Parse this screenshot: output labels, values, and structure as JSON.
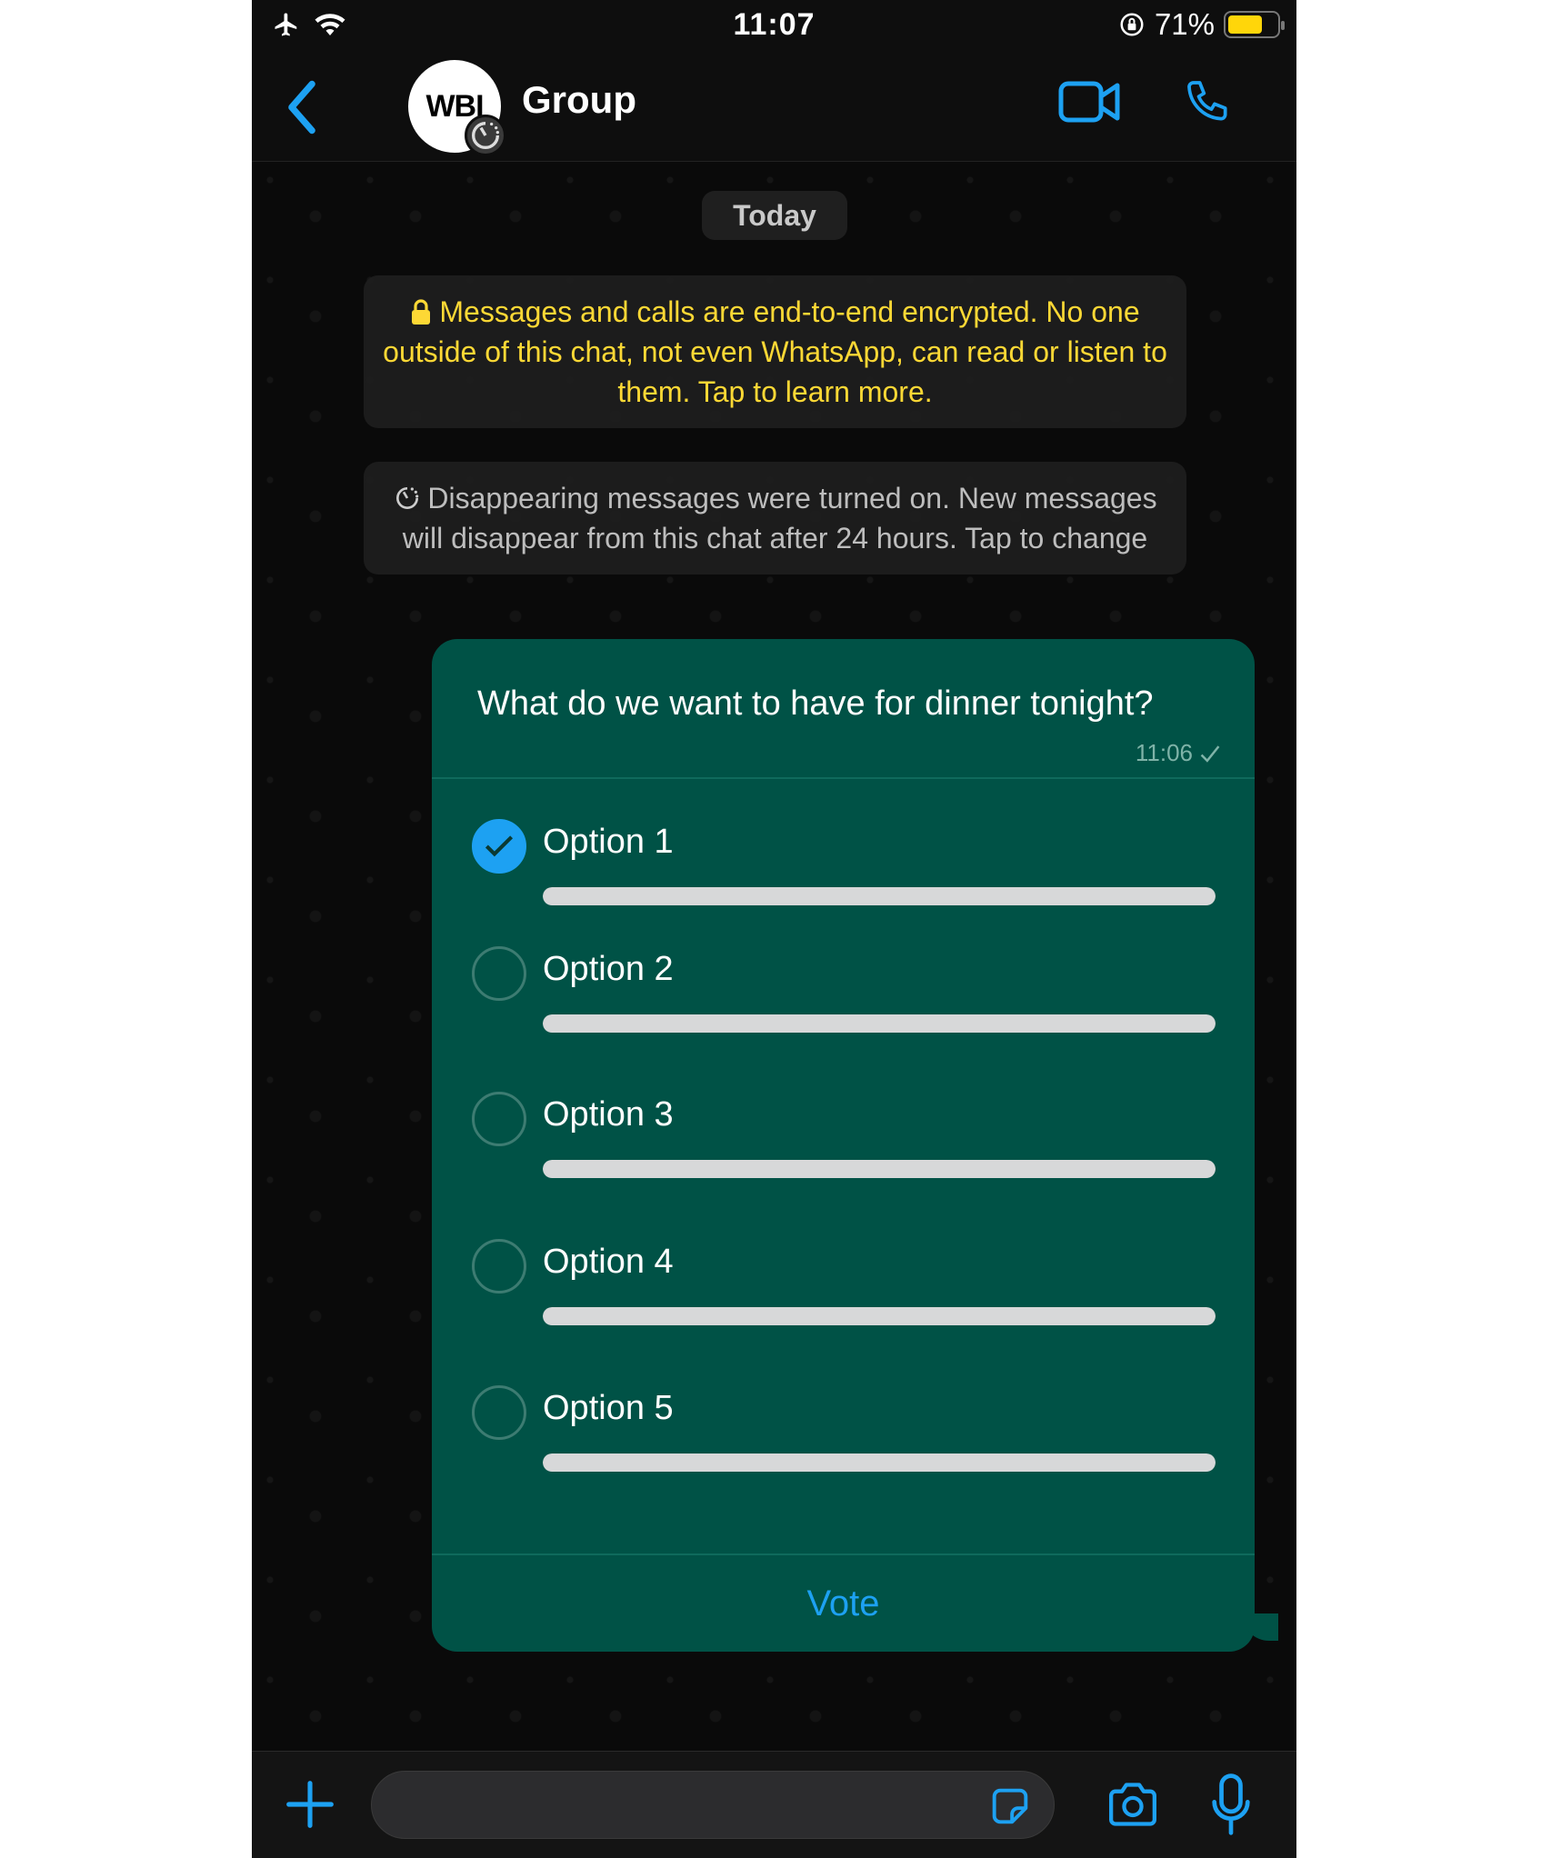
{
  "status_bar": {
    "time": "11:07",
    "battery_percent_label": "71%",
    "battery_level": 0.71,
    "icons": [
      "airplane-icon",
      "wifi-icon",
      "orientation-lock-icon",
      "battery-icon"
    ]
  },
  "header": {
    "title": "Group",
    "avatar_text": "WBI",
    "icons": [
      "back-chevron-icon",
      "disappearing-timer-icon",
      "video-call-icon",
      "phone-call-icon"
    ]
  },
  "chat": {
    "date_separator": "Today",
    "encryption_notice": "Messages and calls are end-to-end encrypted. No one outside of this chat, not even WhatsApp, can read or listen to them. Tap to learn more.",
    "disappearing_notice": "Disappearing messages were turned on. New messages will disappear from this chat after 24 hours. Tap to change"
  },
  "poll": {
    "question": "What do we want to have for dinner tonight?",
    "timestamp": "11:06",
    "status_icon": "sent-check-icon",
    "options": [
      {
        "label": "Option 1",
        "selected": true,
        "fill": 1.0
      },
      {
        "label": "Option 2",
        "selected": false,
        "fill": 1.0
      },
      {
        "label": "Option 3",
        "selected": false,
        "fill": 1.0
      },
      {
        "label": "Option 4",
        "selected": false,
        "fill": 1.0
      },
      {
        "label": "Option 5",
        "selected": false,
        "fill": 1.0
      }
    ],
    "vote_label": "Vote"
  },
  "composer": {
    "input_value": "",
    "icons": [
      "plus-icon",
      "sticker-icon",
      "camera-icon",
      "microphone-icon"
    ]
  },
  "colors": {
    "accent": "#1da1f2",
    "bubble": "#005246",
    "notice_yellow": "#fdd835",
    "battery": "#ffd60a"
  }
}
